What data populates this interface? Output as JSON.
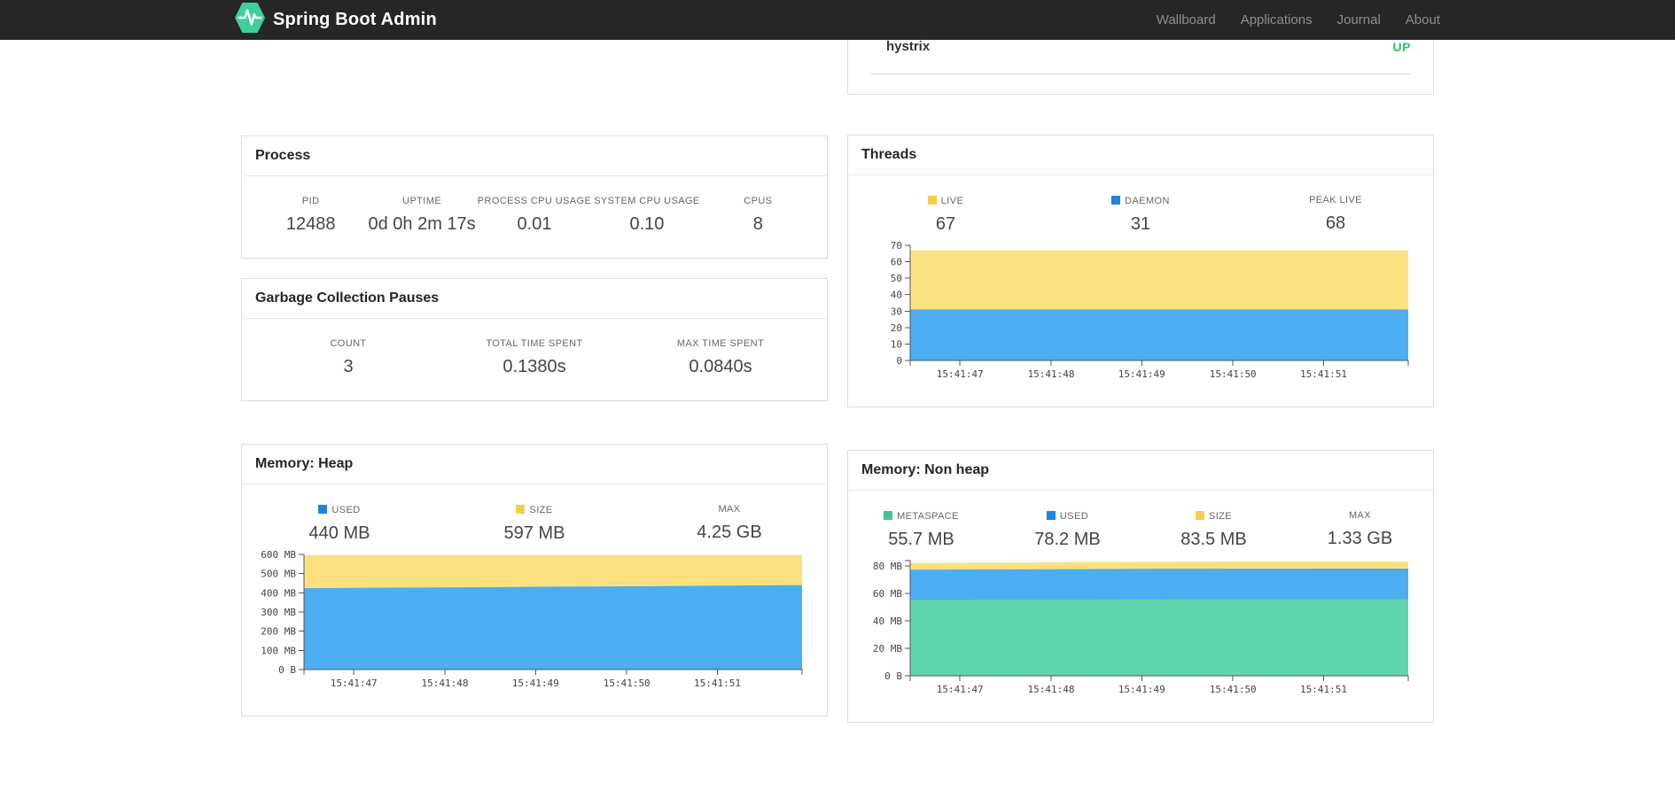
{
  "navbar": {
    "brand": "Spring Boot Admin",
    "items": [
      "Wallboard",
      "Applications",
      "Journal",
      "About"
    ]
  },
  "application_status": {
    "name": "hystrix",
    "status": "UP",
    "status_color": "#23ca61"
  },
  "panels": {
    "process": {
      "title": "Process",
      "stats": [
        {
          "label": "PID",
          "value": "12488"
        },
        {
          "label": "UPTIME",
          "value": "0d 0h 2m 17s"
        },
        {
          "label": "PROCESS CPU USAGE",
          "value": "0.01"
        },
        {
          "label": "SYSTEM CPU USAGE",
          "value": "0.10"
        },
        {
          "label": "CPUS",
          "value": "8"
        }
      ]
    },
    "gc": {
      "title": "Garbage Collection Pauses",
      "stats": [
        {
          "label": "COUNT",
          "value": "3"
        },
        {
          "label": "TOTAL TIME SPENT",
          "value": "0.1380s"
        },
        {
          "label": "MAX TIME SPENT",
          "value": "0.0840s"
        }
      ]
    },
    "threads": {
      "title": "Threads",
      "stats": [
        {
          "label": "LIVE",
          "value": "67",
          "color": "#f6ce4c"
        },
        {
          "label": "DAEMON",
          "value": "31",
          "color": "#1e86df"
        },
        {
          "label": "PEAK LIVE",
          "value": "68"
        }
      ]
    },
    "heap": {
      "title": "Memory: Heap",
      "stats": [
        {
          "label": "USED",
          "value": "440 MB",
          "color": "#1e86df"
        },
        {
          "label": "SIZE",
          "value": "597 MB",
          "color": "#f6ce4c"
        },
        {
          "label": "MAX",
          "value": "4.25 GB"
        }
      ]
    },
    "nonheap": {
      "title": "Memory: Non heap",
      "stats": [
        {
          "label": "METASPACE",
          "value": "55.7 MB",
          "color": "#3ec498"
        },
        {
          "label": "USED",
          "value": "78.2 MB",
          "color": "#1e86df"
        },
        {
          "label": "SIZE",
          "value": "83.5 MB",
          "color": "#f6ce4c"
        },
        {
          "label": "MAX",
          "value": "1.33 GB"
        }
      ]
    }
  },
  "chart_data": [
    {
      "id": "threads",
      "type": "area",
      "title": "Threads",
      "ylim": [
        0,
        70
      ],
      "yticks": [
        {
          "v": 0,
          "label": "0"
        },
        {
          "v": 10,
          "label": "10"
        },
        {
          "v": 20,
          "label": "20"
        },
        {
          "v": 30,
          "label": "30"
        },
        {
          "v": 40,
          "label": "40"
        },
        {
          "v": 50,
          "label": "50"
        },
        {
          "v": 60,
          "label": "60"
        },
        {
          "v": 70,
          "label": "70"
        }
      ],
      "x_tick_fracs": [
        0.1,
        0.283,
        0.465,
        0.648,
        0.83
      ],
      "x_tick_labels": [
        "15:41:47",
        "15:41:48",
        "15:41:49",
        "15:41:50",
        "15:41:51"
      ],
      "series": [
        {
          "name": "LIVE",
          "legend_color": "#f6ce4c",
          "area_color": "#fde180",
          "values": [
            67,
            67,
            67,
            67,
            67,
            67
          ]
        },
        {
          "name": "DAEMON",
          "legend_color": "#1e86df",
          "area_color": "#4baef0",
          "values": [
            31,
            31,
            31,
            31,
            31,
            31
          ]
        }
      ]
    },
    {
      "id": "heap",
      "type": "area",
      "title": "Memory: Heap",
      "ylim": [
        0,
        600
      ],
      "yticks": [
        {
          "v": 0,
          "label": "0 B"
        },
        {
          "v": 100,
          "label": "100 MB"
        },
        {
          "v": 200,
          "label": "200 MB"
        },
        {
          "v": 300,
          "label": "300 MB"
        },
        {
          "v": 400,
          "label": "400 MB"
        },
        {
          "v": 500,
          "label": "500 MB"
        },
        {
          "v": 600,
          "label": "600 MB"
        }
      ],
      "x_tick_fracs": [
        0.1,
        0.283,
        0.465,
        0.648,
        0.83
      ],
      "x_tick_labels": [
        "15:41:47",
        "15:41:48",
        "15:41:49",
        "15:41:50",
        "15:41:51"
      ],
      "series": [
        {
          "name": "SIZE",
          "legend_color": "#f6ce4c",
          "area_color": "#fde180",
          "values": [
            597,
            597,
            597,
            597,
            597,
            597,
            597
          ]
        },
        {
          "name": "USED",
          "legend_color": "#1e86df",
          "area_color": "#4baef0",
          "values": [
            424,
            427,
            429,
            432,
            434,
            437,
            440
          ]
        }
      ]
    },
    {
      "id": "nonheap",
      "type": "area",
      "title": "Memory: Non heap",
      "ylim": [
        0,
        84
      ],
      "yticks": [
        {
          "v": 0,
          "label": "0 B"
        },
        {
          "v": 20,
          "label": "20 MB"
        },
        {
          "v": 40,
          "label": "40 MB"
        },
        {
          "v": 60,
          "label": "60 MB"
        },
        {
          "v": 80,
          "label": "80 MB"
        }
      ],
      "x_tick_fracs": [
        0.1,
        0.283,
        0.465,
        0.648,
        0.83
      ],
      "x_tick_labels": [
        "15:41:47",
        "15:41:48",
        "15:41:49",
        "15:41:50",
        "15:41:51"
      ],
      "series": [
        {
          "name": "SIZE",
          "legend_color": "#f6ce4c",
          "area_color": "#fde180",
          "values": [
            82.4,
            82.6,
            83.0,
            83.2,
            83.5,
            83.5,
            83.5
          ]
        },
        {
          "name": "USED",
          "legend_color": "#1e86df",
          "area_color": "#4baef0",
          "values": [
            77.4,
            77.6,
            77.8,
            78.0,
            78.1,
            78.2,
            78.2
          ]
        },
        {
          "name": "METASPACE",
          "legend_color": "#3ec498",
          "area_color": "#5ed6ac",
          "values": [
            55.3,
            55.4,
            55.5,
            55.6,
            55.7,
            55.7,
            55.7
          ]
        }
      ]
    }
  ]
}
